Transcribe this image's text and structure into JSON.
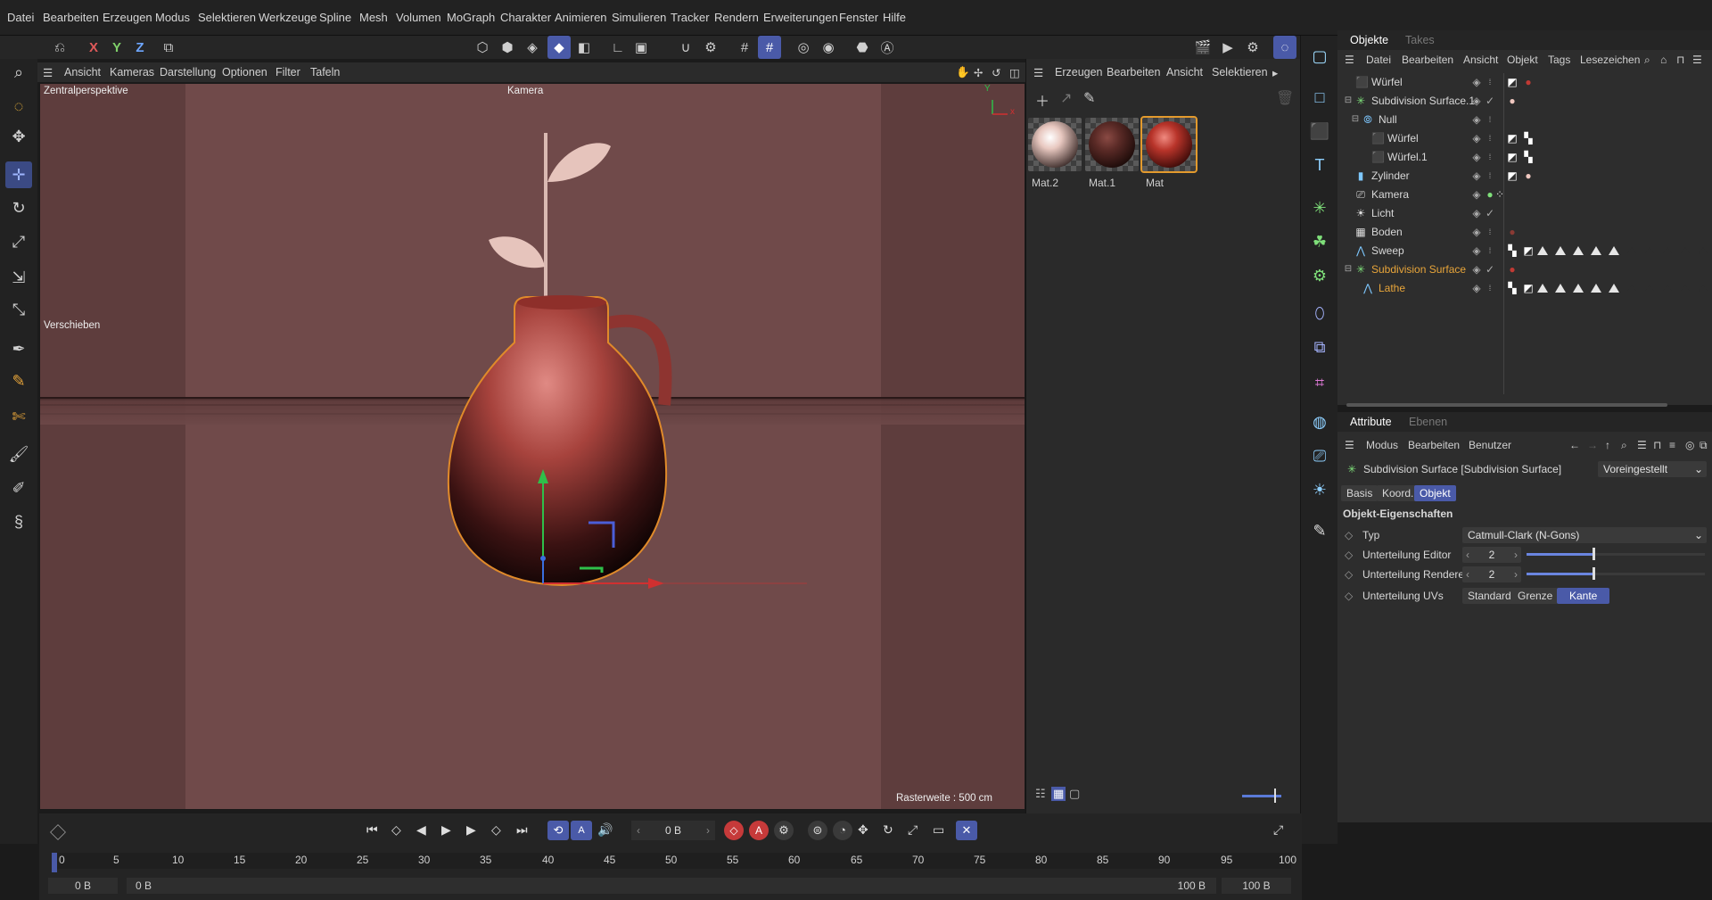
{
  "menubar": [
    "Datei",
    "Bearbeiten",
    "Erzeugen",
    "Modus",
    "Selektieren",
    "Werkzeuge",
    "Spline",
    "Mesh",
    "Volumen",
    "MoGraph",
    "Charakter",
    "Animieren",
    "Simulieren",
    "Tracker",
    "Rendern",
    "Erweiterungen",
    "Fenster",
    "Hilfe"
  ],
  "toolbar": {
    "axis_x": "X",
    "axis_y": "Y",
    "axis_z": "Z"
  },
  "viewport": {
    "menu": [
      "Ansicht",
      "Kameras",
      "Darstellung",
      "Optionen",
      "Filter",
      "Tafeln"
    ],
    "projection": "Zentralperspektive",
    "camera_label": "Kamera",
    "tool_label": "Verschieben",
    "grid_info": "Rasterweite : 500 cm",
    "axis_x": "x",
    "axis_y": "Y"
  },
  "material_manager": {
    "menu": [
      "Erzeugen",
      "Bearbeiten",
      "Ansicht",
      "Selektieren"
    ],
    "materials": [
      {
        "name": "Mat.2",
        "color": "#e8c8c0"
      },
      {
        "name": "Mat.1",
        "color": "#5a2a26"
      },
      {
        "name": "Mat",
        "color": "#b8342a"
      }
    ]
  },
  "object_manager": {
    "tabs": [
      "Objekte",
      "Takes"
    ],
    "menu": [
      "Datei",
      "Bearbeiten",
      "Ansicht",
      "Objekt",
      "Tags",
      "Lesezeichen"
    ],
    "rows": [
      {
        "name": "Würfel",
        "icon": "cube-icon",
        "highlight": false
      },
      {
        "name": "Subdivision Surface.1",
        "icon": "subdivision-icon",
        "highlight": false
      },
      {
        "name": "Null",
        "icon": "null-icon",
        "highlight": false
      },
      {
        "name": "Würfel",
        "icon": "cube-icon",
        "highlight": false
      },
      {
        "name": "Würfel.1",
        "icon": "cube-icon",
        "highlight": false
      },
      {
        "name": "Zylinder",
        "icon": "cylinder-icon",
        "highlight": false
      },
      {
        "name": "Kamera",
        "icon": "camera-icon",
        "highlight": false
      },
      {
        "name": "Licht",
        "icon": "light-icon",
        "highlight": false
      },
      {
        "name": "Boden",
        "icon": "floor-icon",
        "highlight": false
      },
      {
        "name": "Sweep",
        "icon": "sweep-icon",
        "highlight": false
      },
      {
        "name": "Subdivision Surface",
        "icon": "subdivision-icon",
        "highlight": true
      },
      {
        "name": "Lathe",
        "icon": "lathe-icon",
        "highlight": true
      }
    ]
  },
  "attribute_manager": {
    "tabs": [
      "Attribute",
      "Ebenen"
    ],
    "menu": [
      "Modus",
      "Bearbeiten",
      "Benutzer"
    ],
    "object_title": "Subdivision Surface [Subdivision Surface]",
    "preset": "Voreingestellt",
    "subtabs": [
      "Basis",
      "Koord.",
      "Objekt"
    ],
    "active_subtab": "Objekt",
    "section_title": "Objekt-Eigenschaften",
    "typ_label": "Typ",
    "typ_value": "Catmull-Clark (N-Gons)",
    "editor_label": "Unterteilung Editor",
    "editor_value": "2",
    "renderer_label": "Unterteilung Renderer",
    "renderer_value": "2",
    "uv_label": "Unterteilung UVs",
    "uv_options": [
      "Standard",
      "Grenze",
      "Kante"
    ],
    "uv_selected": "Kante"
  },
  "timeline": {
    "current_frame": "0 B",
    "ticks": [
      "0",
      "5",
      "10",
      "15",
      "20",
      "25",
      "30",
      "35",
      "40",
      "45",
      "50",
      "55",
      "60",
      "65",
      "70",
      "75",
      "80",
      "85",
      "90",
      "95",
      "100"
    ],
    "start_field": "0 B",
    "start_field2": "0 B",
    "end_field": "100 B",
    "end_field2": "100 B"
  }
}
